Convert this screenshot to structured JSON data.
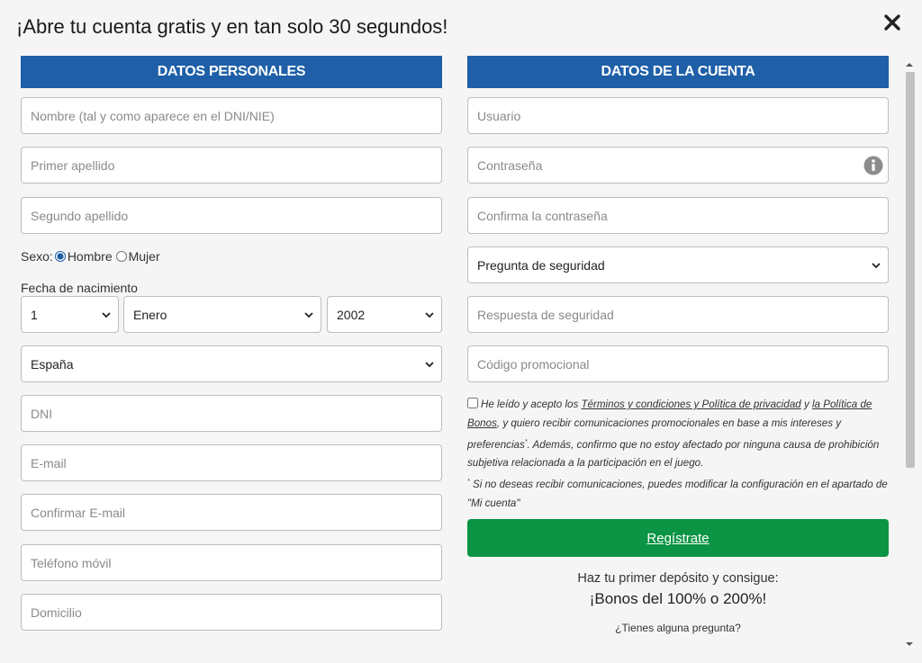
{
  "modal": {
    "title": "¡Abre tu cuenta gratis y en tan solo 30 segundos!"
  },
  "personal": {
    "header": "DATOS PERSONALES",
    "nombre_placeholder": "Nombre (tal y como aparece en el DNI/NIE)",
    "apellido1_placeholder": "Primer apellido",
    "apellido2_placeholder": "Segundo apellido",
    "sexo_label": "Sexo:",
    "sexo_hombre": "Hombre",
    "sexo_mujer": "Mujer",
    "sexo_selected": "Hombre",
    "fecha_label": "Fecha de nacimiento",
    "dia_value": "1",
    "mes_value": "Enero",
    "anio_value": "2002",
    "pais_value": "España",
    "dni_placeholder": "DNI",
    "email_placeholder": "E-mail",
    "email_confirm_placeholder": "Confirmar E-mail",
    "telefono_placeholder": "Teléfono móvil",
    "domicilio_placeholder": "Domicilio"
  },
  "account": {
    "header": "DATOS DE LA CUENTA",
    "usuario_placeholder": "Usuario",
    "password_placeholder": "Contraseña",
    "password_confirm_placeholder": "Confirma la contraseña",
    "pregunta_value": "Pregunta de seguridad",
    "respuesta_placeholder": "Respuesta de seguridad",
    "codigo_placeholder": "Código promocional"
  },
  "terms": {
    "text_before": "He leído y acepto los ",
    "link_terms": "Términos y condiciones y Política de privacidad",
    "text_and": " y ",
    "link_bonos": "la Política de Bonos",
    "text_after": ", y quiero recibir comunicaciones promocionales en base a mis intereses y preferencias",
    "asterisk": "*",
    "text_confirm": ". Además, confirmo que no estoy afectado por ninguna causa de prohibición subjetiva relacionada a la participación en el juego.",
    "note_asterisk": "*",
    "note": " Si no deseas recibir comunicaciones, puedes modificar la configuración en el apartado de \"Mi cuenta\""
  },
  "cta": {
    "register_label": "Regístrate",
    "promo_line1": "Haz tu primer depósito y consigue:",
    "promo_line2": "¡Bonos del 100% o 200%!",
    "question": "¿Tienes alguna pregunta?"
  },
  "colors": {
    "header_blue": "#1e5fa8",
    "register_green": "#0b9444"
  }
}
